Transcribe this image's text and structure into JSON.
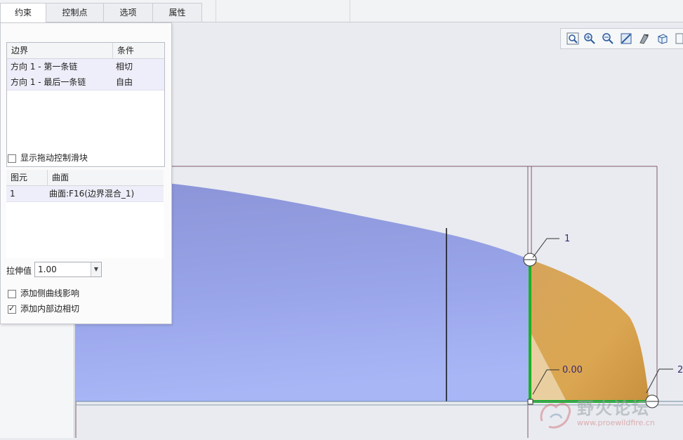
{
  "tabs": [
    {
      "label": "约束",
      "active": true
    },
    {
      "label": "控制点",
      "active": false
    },
    {
      "label": "选项",
      "active": false
    },
    {
      "label": "属性",
      "active": false
    }
  ],
  "boundary_table": {
    "headers": [
      "边界",
      "条件"
    ],
    "rows": [
      {
        "boundary": "方向 1 - 第一条链",
        "condition": "相切"
      },
      {
        "boundary": "方向 1 - 最后一条链",
        "condition": "自由"
      }
    ]
  },
  "show_drag_handles": {
    "label": "显示拖动控制滑块",
    "checked": false
  },
  "element_table": {
    "headers": [
      "图元",
      "曲面"
    ],
    "rows": [
      {
        "element": "1",
        "surface": "曲面:F16(边界混合_1)"
      }
    ]
  },
  "stretch": {
    "label": "拉伸值",
    "value": "1.00"
  },
  "add_side_curve": {
    "label": "添加侧曲线影响",
    "checked": false
  },
  "add_inner_tangent": {
    "label": "添加内部边相切",
    "checked": true
  },
  "toolbar_icons": [
    "zoom-fit-icon",
    "zoom-in-icon",
    "zoom-out-icon",
    "repaint-icon",
    "display-style-icon",
    "view-cube-icon",
    "more-icon"
  ],
  "viewport_labels": {
    "label1": "1",
    "label2": "2",
    "value": "0.00"
  },
  "colors": {
    "blue_surface": "#9aa4e4",
    "orange_surface": "#d9a24f",
    "green_edge": "#19b21f",
    "accent_tab": "#ffffff"
  },
  "watermark": {
    "brand": "野火论坛",
    "url": "www.proewildfire.cn"
  }
}
